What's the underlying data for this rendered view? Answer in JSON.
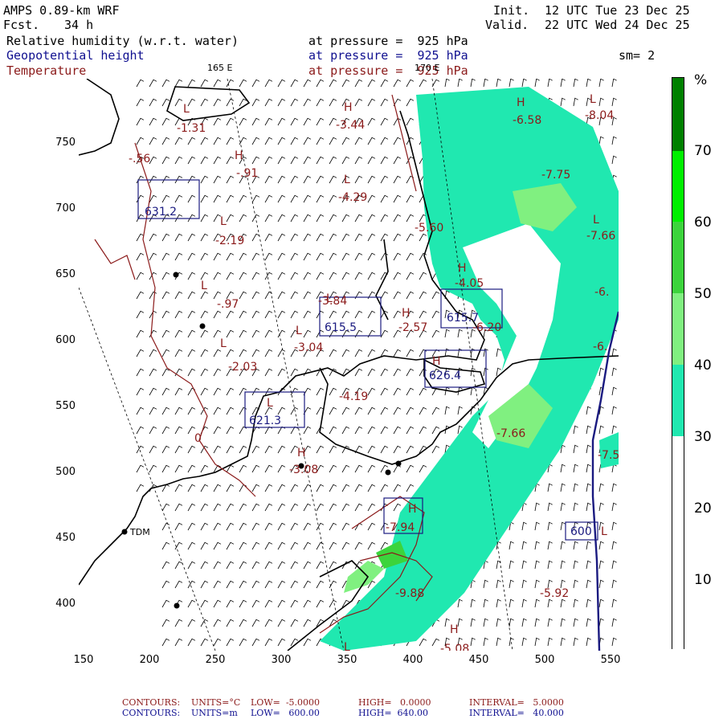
{
  "header": {
    "model": "AMPS 0.89-km WRF",
    "fcst_label": "Fcst.",
    "fcst_value": "34 h",
    "init_label": "Init.",
    "init_value": "12 UTC Tue 23 Dec 25",
    "valid_label": "Valid.",
    "valid_value": "22 UTC Wed 24 Dec 25",
    "field1": "Relative humidity (w.r.t. water)",
    "field2": "Geopotential height",
    "field3": "Temperature",
    "pressure1": "at pressure =  925 hPa",
    "pressure2": "at pressure =  925 hPa",
    "pressure3": "at pressure =  925 hPa",
    "smoothing": "sm= 2"
  },
  "map": {
    "lon_165": "165 E",
    "lon_170": "170 E",
    "station_tdm": "TDM",
    "y_ticks": [
      "750",
      "700",
      "650",
      "600",
      "550",
      "500",
      "450",
      "400"
    ],
    "x_ticks": [
      "150",
      "200",
      "250",
      "300",
      "350",
      "400",
      "450",
      "500",
      "550"
    ],
    "temp_labels": [
      "-1.31",
      "-3.44",
      "-6.58",
      "-8.04",
      "-.91",
      "-4.29",
      "-7.75",
      "-.56",
      "-2.19",
      "-5.60",
      "-7.66",
      "-4.05",
      "-6.",
      "-.97",
      "-3.84",
      "-2.57",
      "-6.20",
      "-3.04",
      "-6.",
      "-2.03",
      "-4.19",
      "-7.66",
      "0",
      "-3.08",
      "-7.5",
      "-7.94",
      "-9.88",
      "-5.08",
      "-5.92"
    ],
    "height_labels": [
      "631.2",
      "615.5",
      "615.7",
      "626.4",
      "621.3",
      "600"
    ],
    "colors": {
      "rh_30": "#20e8b0",
      "rh_40": "#80f080",
      "rh_50": "#3cd43c",
      "rh_60": "#00f000",
      "rh_70": "#008000",
      "coast": "#000000",
      "temp": "#8b1a1a",
      "height": "#1a1a80"
    }
  },
  "colorbar": {
    "unit": "%",
    "levels": [
      "70",
      "60",
      "50",
      "40",
      "30",
      "20",
      "10"
    ]
  },
  "footer": {
    "line1_label": "CONTOURS:",
    "line1_units": "UNITS=°C",
    "line1_low": "LOW=  -5.0000",
    "line1_high": "HIGH=   0.0000",
    "line1_interval": "INTERVAL=   5.0000",
    "line2_label": "CONTOURS:",
    "line2_units": "UNITS=m",
    "line2_low": "LOW=   600.00",
    "line2_high": "HIGH=  640.00",
    "line2_interval": "INTERVAL=   40.000"
  }
}
